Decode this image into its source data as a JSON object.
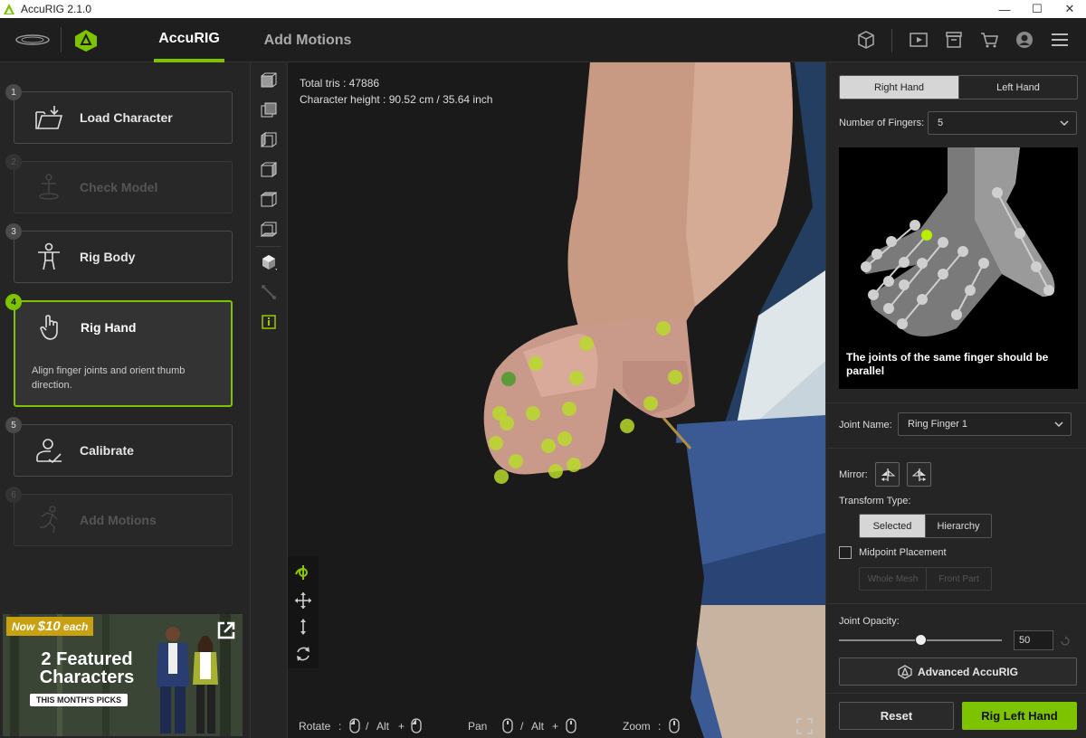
{
  "window": {
    "title": "AccuRIG 2.1.0"
  },
  "nav": {
    "tab_accurig": "AccuRIG",
    "tab_add_motions": "Add Motions"
  },
  "steps": [
    {
      "num": "1",
      "label": "Load Character"
    },
    {
      "num": "2",
      "label": "Check Model"
    },
    {
      "num": "3",
      "label": "Rig Body"
    },
    {
      "num": "4",
      "label": "Rig Hand",
      "desc": "Align finger joints and orient thumb direction."
    },
    {
      "num": "5",
      "label": "Calibrate"
    },
    {
      "num": "6",
      "label": "Add Motions"
    }
  ],
  "promo": {
    "price_prefix": "Now ",
    "price": "$10",
    "price_suffix": " each",
    "headline": "2 Featured Characters",
    "picks": "THIS MONTH'S PICKS"
  },
  "viewport": {
    "tris": "Total tris : 47886",
    "height": "Character height : 90.52 cm / 35.64 inch",
    "rotate": "Rotate",
    "pan": "Pan",
    "zoom": "Zoom",
    "alt": "Alt",
    "colon": ":",
    "slash": "/",
    "plus": "+"
  },
  "right": {
    "hand_right": "Right Hand",
    "hand_left": "Left Hand",
    "fingers_label": "Number of Fingers:",
    "fingers_value": "5",
    "preview_caption": "The joints of the same finger should be parallel",
    "joint_label": "Joint Name:",
    "joint_value": "Ring Finger 1",
    "mirror_label": "Mirror:",
    "transform_label": "Transform Type:",
    "transform_selected": "Selected",
    "transform_hierarchy": "Hierarchy",
    "midpoint_label": "Midpoint Placement",
    "whole_mesh": "Whole Mesh",
    "front_part": "Front Part",
    "opacity_label": "Joint Opacity:",
    "opacity_value": "50",
    "opacity_fraction": 0.5,
    "advanced": "Advanced AccuRIG",
    "reset": "Reset",
    "rig": "Rig Left Hand"
  },
  "colors": {
    "accent": "#7ec300",
    "joint": "#b8d92a"
  }
}
